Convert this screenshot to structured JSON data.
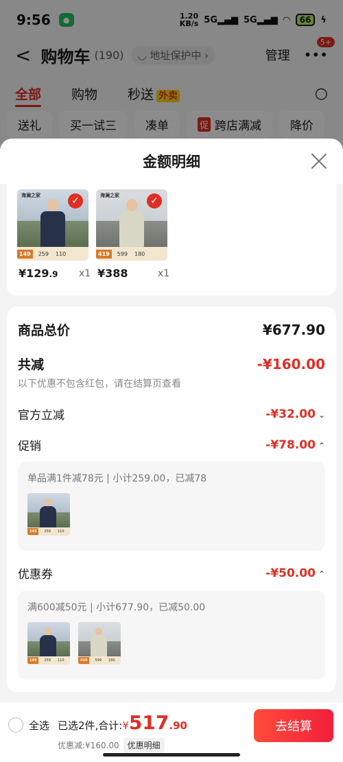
{
  "status": {
    "time": "9:56",
    "speed_top": "1.20",
    "speed_bottom": "KB/s",
    "sig1": "5G",
    "sig2": "5G",
    "battery": "66"
  },
  "nav": {
    "back": "<",
    "title": "购物车",
    "count": "(190)",
    "address": "地址保护中",
    "manage": "管理",
    "badge": "5+"
  },
  "tabs": {
    "all": "全部",
    "shop": "购物",
    "flash": "秒送",
    "waimai": "外卖"
  },
  "chips": {
    "c1": "送礼",
    "c2": "买一试三",
    "c3": "凑单",
    "c4_badge": "促",
    "c4": "跨店满减",
    "c5": "降价"
  },
  "sheet": {
    "title": "金额明细"
  },
  "products": [
    {
      "price_main": "¥129",
      "price_dec": ".9",
      "qty": "x1",
      "tag": "149",
      "mid": "259",
      "right": "110",
      "brand": "海澜之家"
    },
    {
      "price_main": "¥388",
      "price_dec": "",
      "qty": "x1",
      "tag": "419",
      "mid": "599",
      "right": "180",
      "brand": "海澜之家"
    }
  ],
  "totals": {
    "goods_label": "商品总价",
    "goods_value": "¥677.90",
    "reduce_label": "共减",
    "reduce_value": "-¥160.00",
    "note": "以下优惠不包含红包，请在结算页查看",
    "official_label": "官方立减",
    "official_value": "-¥32.00",
    "promo_label": "促销",
    "promo_value": "-¥78.00",
    "promo_desc": "单品满1件减78元 | 小计259.00，已减78",
    "coupon_label": "优惠券",
    "coupon_value": "-¥50.00",
    "coupon_desc": "满600减50元 | 小计677.90，已减50.00"
  },
  "bottom": {
    "select_all": "全选",
    "selected_prefix": "已选2件,合计:",
    "yen": "¥",
    "amount": "517",
    "decimal": ".90",
    "discount_text": "优惠减:¥160.00",
    "detail_button": "优惠明细",
    "checkout": "去结算"
  },
  "colors": {
    "accent": "#e02e24"
  }
}
